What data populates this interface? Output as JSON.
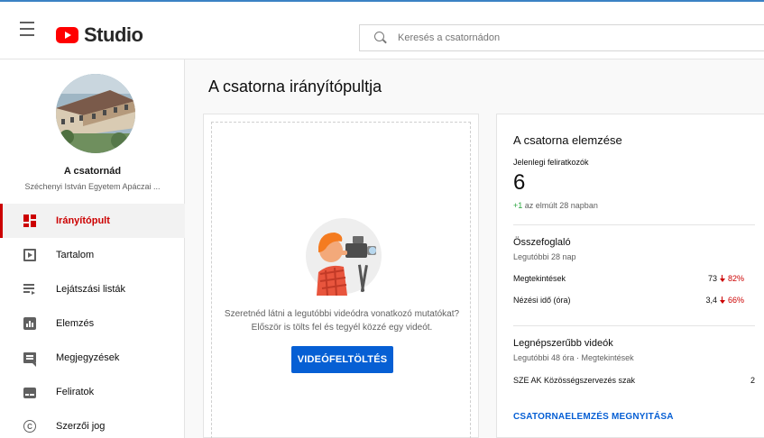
{
  "app": {
    "logo_text": "Studio"
  },
  "search": {
    "placeholder": "Keresés a csatornádon"
  },
  "sidebar": {
    "channel_label": "A csatornád",
    "channel_name": "Széchenyi István Egyetem Apáczai ...",
    "items": [
      {
        "label": "Irányítópult",
        "icon": "dashboard-icon",
        "active": true
      },
      {
        "label": "Tartalom",
        "icon": "content-icon"
      },
      {
        "label": "Lejátszási listák",
        "icon": "playlist-icon"
      },
      {
        "label": "Elemzés",
        "icon": "analytics-icon"
      },
      {
        "label": "Megjegyzések",
        "icon": "comments-icon"
      },
      {
        "label": "Feliratok",
        "icon": "subtitles-icon"
      },
      {
        "label": "Szerzői jog",
        "icon": "copyright-icon"
      }
    ]
  },
  "main": {
    "title": "A csatorna irányítópultja"
  },
  "upload_card": {
    "text_line1": "Szeretnéd látni a legutóbbi videódra vonatkozó mutatókat?",
    "text_line2": "Először is tölts fel és tegyél közzé egy videót.",
    "button_label": "VIDEÓFELTÖLTÉS"
  },
  "analytics_card": {
    "title": "A csatorna elemzése",
    "subscribers_label": "Jelenlegi feliratkozók",
    "subscribers_count": "6",
    "change_value": "+1",
    "change_text": " az elmúlt 28 napban",
    "summary": {
      "title": "Összefoglaló",
      "period": "Legutóbbi 28 nap",
      "rows": [
        {
          "label": "Megtekintések",
          "value": "73",
          "change": "82%"
        },
        {
          "label": "Nézési idő (óra)",
          "value": "3,4",
          "change": "66%"
        }
      ]
    },
    "top_videos": {
      "title": "Legnépszerűbb videók",
      "period": "Legutóbbi 48 óra · Megtekintések",
      "rows": [
        {
          "title": "SZE AK Közösségszervezés szak",
          "views": "2"
        }
      ]
    },
    "open_link": "CSATORNAELEMZÉS MEGNYITÁSA"
  },
  "colors": {
    "accent_red": "#cc0000",
    "primary_blue": "#065fd4",
    "positive_green": "#2ba640"
  }
}
